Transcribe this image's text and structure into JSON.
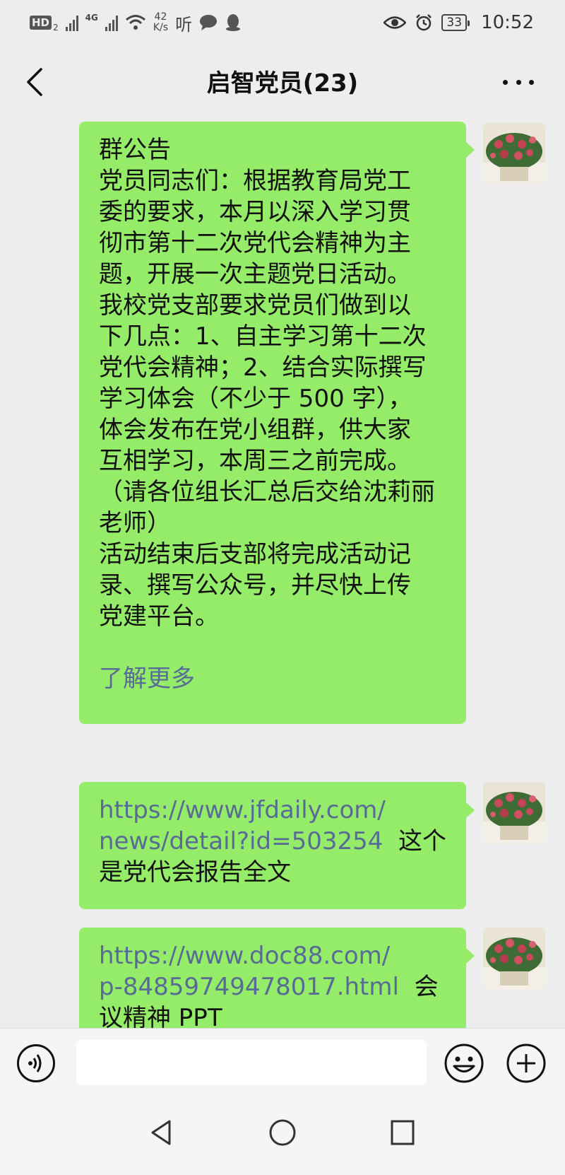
{
  "status_bar": {
    "hd_badge": "HD",
    "sim_index": "2",
    "network": "4G",
    "speed_value": "42",
    "speed_unit": "K/s",
    "listen_glyph": "听",
    "battery": "33",
    "time": "10:52"
  },
  "nav": {
    "title": "启智党员(23)"
  },
  "messages": [
    {
      "lines": [
        "群公告",
        "党员同志们：根据教育局党工",
        "委的要求，本月以深入学习贯",
        "彻市第十二次党代会精神为主",
        "题，开展一次主题党日活动。",
        "我校党支部要求党员们做到以",
        "下几点：1、自主学习第十二次",
        "党代会精神；2、结合实际撰写",
        "学习体会（不少于 500 字），",
        "体会发布在党小组群，供大家",
        "互相学习，本周三之前完成。",
        "（请各位组长汇总后交给沈莉丽",
        "老师）",
        "活动结束后支部将完成活动记",
        "录、撰写公众号，并尽快上传",
        "党建平台。"
      ],
      "more_link": "了解更多"
    },
    {
      "link_line1": "https://www.jfdaily.com/",
      "link_line2": "news/detail?id=503254",
      "suffix2": "这个",
      "line3": "是党代会报告全文"
    },
    {
      "link_line1": "https://www.doc88.com/",
      "link_line2": "p-84859749478017.html",
      "suffix2": "会",
      "line3": "议精神 PPT"
    }
  ],
  "input_bar": {
    "voice_icon": "voice-icon",
    "emoji_icon": "emoji-icon",
    "plus_icon": "plus-icon"
  },
  "colors": {
    "bubble": "#95ec69",
    "link": "#576b95",
    "background": "#ededed"
  }
}
